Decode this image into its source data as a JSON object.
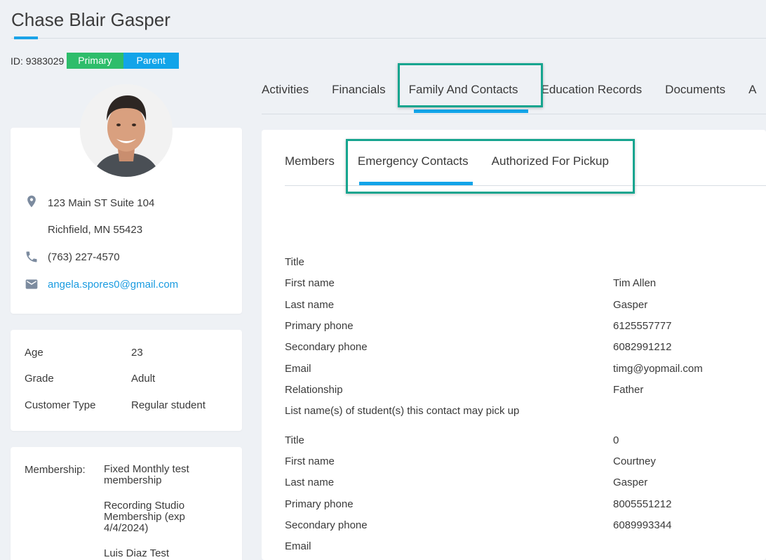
{
  "page": {
    "title": "Chase Blair Gasper"
  },
  "profile": {
    "id_text": "ID: 9383029",
    "badges": [
      "Primary",
      "Parent"
    ],
    "address_line1": "123 Main ST Suite 104",
    "address_line2": "Richfield, MN 55423",
    "phone": "(763) 227-4570",
    "email": "angela.spores0@gmail.com"
  },
  "info": {
    "rows": [
      {
        "label": "Age",
        "value": "23"
      },
      {
        "label": "Grade",
        "value": "Adult"
      },
      {
        "label": "Customer Type",
        "value": "Regular student"
      }
    ]
  },
  "membership": {
    "label": "Membership:",
    "items": [
      "Fixed Monthly test membership",
      "Recording Studio Membership (exp 4/4/2024)",
      "Luis Diaz Test"
    ]
  },
  "tabs": [
    "Activities",
    "Financials",
    "Family And Contacts",
    "Education Records",
    "Documents"
  ],
  "subtabs": [
    "Members",
    "Emergency Contacts",
    "Authorized For Pickup"
  ],
  "contacts": [
    {
      "fields": [
        {
          "label": "Title",
          "value": ""
        },
        {
          "label": "First name",
          "value": "Tim Allen"
        },
        {
          "label": "Last name",
          "value": "Gasper"
        },
        {
          "label": "Primary phone",
          "value": "6125557777"
        },
        {
          "label": "Secondary phone",
          "value": "6082991212"
        },
        {
          "label": "Email",
          "value": "timg@yopmail.com"
        },
        {
          "label": "Relationship",
          "value": "Father"
        },
        {
          "label": "List name(s) of student(s) this contact may pick up",
          "value": ""
        }
      ]
    },
    {
      "fields": [
        {
          "label": "Title",
          "value": "0"
        },
        {
          "label": "First name",
          "value": "Courtney"
        },
        {
          "label": "Last name",
          "value": "Gasper"
        },
        {
          "label": "Primary phone",
          "value": "8005551212"
        },
        {
          "label": "Secondary phone",
          "value": "6089993344"
        },
        {
          "label": "Email",
          "value": ""
        }
      ]
    }
  ],
  "colors": {
    "accent": "#12a4e9",
    "primary_badge": "#2ebd6b",
    "highlight": "#17a58f"
  },
  "icons": {
    "address": "map-pin-icon",
    "phone": "phone-icon",
    "email": "mail-icon"
  }
}
